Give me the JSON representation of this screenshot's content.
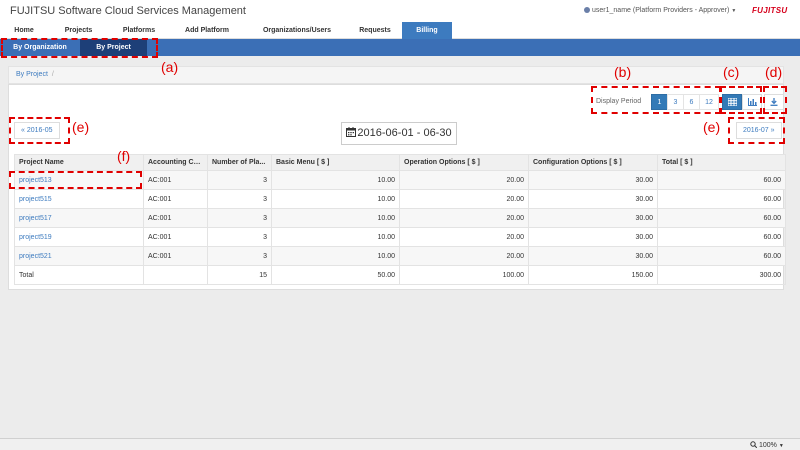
{
  "header": {
    "app_title": "FUJITSU Software Cloud Services Management",
    "user": "user1_name (Platform Providers - Approver)",
    "brand": "FUJITSU"
  },
  "nav": {
    "tabs": [
      {
        "label": "Home"
      },
      {
        "label": "Projects"
      },
      {
        "label": "Platforms"
      },
      {
        "label": "Add Platform"
      },
      {
        "label": "Organizations/Users"
      },
      {
        "label": "Requests"
      },
      {
        "label": "Billing"
      }
    ]
  },
  "subnav": {
    "items": [
      {
        "label": "By Organization"
      },
      {
        "label": "By Project"
      }
    ]
  },
  "breadcrumb": {
    "label": "By Project",
    "sep": "/"
  },
  "toolbar": {
    "display_period_label": "Display Period",
    "periods": [
      "1",
      "3",
      "6",
      "12"
    ],
    "prev_label": "« 2016-05",
    "next_label": "2016-07 »",
    "date_range": "2016-06-01 - 06-30"
  },
  "table": {
    "headers": [
      "Project Name",
      "Accounting Co...",
      "Number of Pla...",
      "Basic Menu [ $ ]",
      "Operation Options [ $ ]",
      "Configuration Options [ $ ]",
      "Total [ $ ]"
    ],
    "rows": [
      {
        "project": "project513",
        "code": "AC:001",
        "num": "3",
        "basic": "10.00",
        "operation": "20.00",
        "configuration": "30.00",
        "total": "60.00"
      },
      {
        "project": "project515",
        "code": "AC:001",
        "num": "3",
        "basic": "10.00",
        "operation": "20.00",
        "configuration": "30.00",
        "total": "60.00"
      },
      {
        "project": "project517",
        "code": "AC:001",
        "num": "3",
        "basic": "10.00",
        "operation": "20.00",
        "configuration": "30.00",
        "total": "60.00"
      },
      {
        "project": "project519",
        "code": "AC:001",
        "num": "3",
        "basic": "10.00",
        "operation": "20.00",
        "configuration": "30.00",
        "total": "60.00"
      },
      {
        "project": "project521",
        "code": "AC:001",
        "num": "3",
        "basic": "10.00",
        "operation": "20.00",
        "configuration": "30.00",
        "total": "60.00"
      }
    ],
    "total": {
      "label": "Total",
      "num": "15",
      "basic": "50.00",
      "operation": "100.00",
      "configuration": "150.00",
      "total": "300.00"
    }
  },
  "annotations": {
    "a": "(a)",
    "b": "(b)",
    "c": "(c)",
    "d": "(d)",
    "e": "(e)",
    "f": "(f)"
  },
  "status": {
    "zoom": "100%"
  },
  "colors": {
    "accent": "#3b6fb6",
    "active_sub": "#1d3f78",
    "annotation": "#e00000"
  }
}
